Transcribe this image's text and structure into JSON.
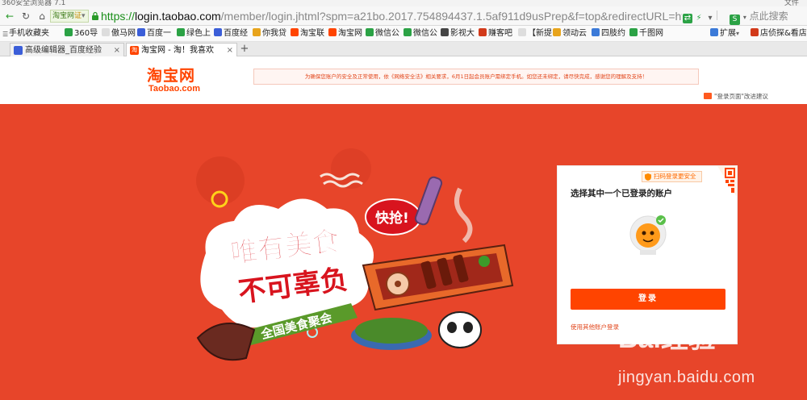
{
  "browser": {
    "window_title": "360安全浏览器 7.1",
    "window_menu": "文件",
    "site_badge": "淘宝网",
    "site_badge_flag": "证",
    "url": {
      "scheme": "https://",
      "host": "login.taobao.com",
      "path": "/member/login.jhtml?spm=a21bo.2017.754894437.1.5af911d9usPrep&f=top&redirectURL=https%3A%"
    },
    "search_placeholder": "点此搜索",
    "bookmarks": [
      {
        "label": "手机收藏夹",
        "color": "#3b7ad8"
      },
      {
        "label": "360导",
        "color": "#2ba245"
      },
      {
        "label": "傲马网",
        "color": "#999999"
      },
      {
        "label": "百度一",
        "color": "#3b5ed8"
      },
      {
        "label": "绿色上",
        "color": "#2ba245"
      },
      {
        "label": "百度经",
        "color": "#3b5ed8"
      },
      {
        "label": "你我贷",
        "color": "#e8a41c"
      },
      {
        "label": "淘宝联",
        "color": "#ff4400"
      },
      {
        "label": "淘宝网",
        "color": "#ff4400"
      },
      {
        "label": "微信公",
        "color": "#2ba245"
      },
      {
        "label": "微信公",
        "color": "#2ba245"
      },
      {
        "label": "影视大",
        "color": "#444444"
      },
      {
        "label": "赚客吧",
        "color": "#d23a1a"
      },
      {
        "label": "【新提",
        "color": "#999999"
      },
      {
        "label": "领动云",
        "color": "#e8a41c"
      },
      {
        "label": "四肢约",
        "color": "#3b7ad8"
      },
      {
        "label": "千图网",
        "color": "#2ba245"
      }
    ],
    "bookmark_extra": {
      "expand": "扩展",
      "shop": "店侦探&看店"
    },
    "tabs": [
      {
        "label": "高级编辑器_百度经验",
        "fav": "#3b5ed8",
        "active": false
      },
      {
        "label": "淘宝网 - 淘！我喜欢",
        "fav": "#ff4400",
        "active": true
      }
    ],
    "new_tab": "+"
  },
  "page": {
    "logo_cn": "淘宝网",
    "logo_en": "Taobao.com",
    "notice": "为确保您账户的安全及正常使用，依《网络安全法》相关要求，6月1日起会员账户需绑定手机。如您还未绑定，请尽快完成，感谢您的理解及支持！",
    "feedback": "\"登录页面\"改进建议",
    "banner": {
      "bg_color": "#e7452a",
      "headline_1": "唯有美食",
      "headline_2": "不可辜负",
      "ribbon": "全国美食聚会",
      "bubble": "快抢!"
    },
    "login": {
      "qr_tip": "扫码登录更安全",
      "title": "选择其中一个已登录的账户",
      "button": "登录",
      "other_account": "使用其他账户登录"
    },
    "watermark": {
      "logo": "Bai经验",
      "url": "jingyan.baidu.com"
    }
  }
}
